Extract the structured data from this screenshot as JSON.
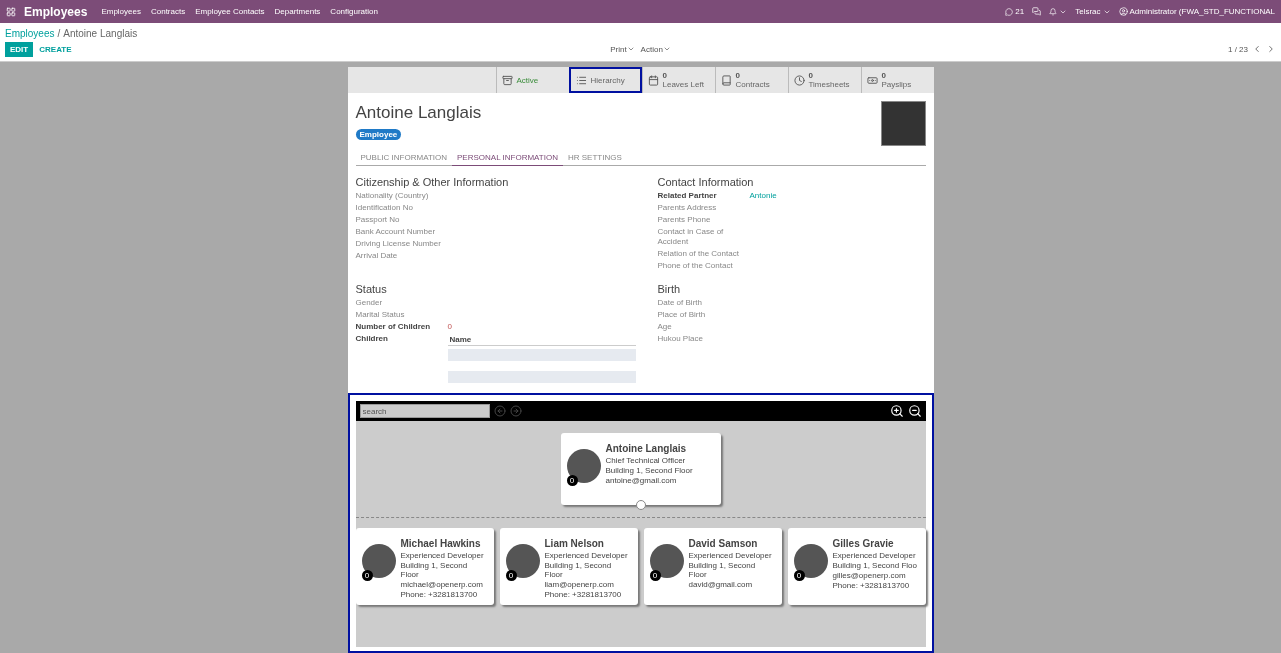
{
  "navbar": {
    "app_title": "Employees",
    "menu": [
      "Employees",
      "Contracts",
      "Employee Contacts",
      "Departments",
      "Configuration"
    ],
    "chat_count": "21",
    "company": "Telsrac",
    "user": "Administrator (FWA_STD_FUNCTIONAL"
  },
  "breadcrumb": {
    "parent": "Employees",
    "separator": "/",
    "current": "Antoine Langlais"
  },
  "actions": {
    "edit": "EDIT",
    "create": "CREATE",
    "print": "Print",
    "action": "Action",
    "pager": "1 / 23"
  },
  "smart_buttons": [
    {
      "kind": "archive",
      "label": "Active",
      "highlighted": false
    },
    {
      "kind": "list",
      "label": "Hierarchy",
      "highlighted": true
    },
    {
      "kind": "calendar",
      "count": "0",
      "label": "Leaves Left",
      "highlighted": false
    },
    {
      "kind": "book",
      "count": "0",
      "label": "Contracts",
      "highlighted": false
    },
    {
      "kind": "clock",
      "count": "0",
      "label": "Timesheets",
      "highlighted": false
    },
    {
      "kind": "money",
      "count": "0",
      "label": "Payslips",
      "highlighted": false
    }
  ],
  "employee": {
    "name": "Antoine Langlais",
    "tag": "Employee"
  },
  "tabs": [
    {
      "label": "PUBLIC INFORMATION",
      "selected": false
    },
    {
      "label": "PERSONAL INFORMATION",
      "selected": true
    },
    {
      "label": "HR SETTINGS",
      "selected": false
    }
  ],
  "groups": [
    {
      "title": "Citizenship & Other Information",
      "fields": [
        {
          "label": "Nationality (Country)",
          "required": false
        },
        {
          "label": "Identification No",
          "required": false
        },
        {
          "label": "Passport No",
          "required": false
        },
        {
          "label": "Bank Account Number",
          "required": false
        },
        {
          "label": "Driving License Number",
          "required": false
        },
        {
          "label": "Arrival Date",
          "required": false
        }
      ]
    },
    {
      "title": "Contact Information",
      "fields": [
        {
          "label": "Related Partner",
          "required": true,
          "kind": "link",
          "value": "Antonie"
        },
        {
          "label": "Parents Address",
          "required": false
        },
        {
          "label": "Parents Phone",
          "required": false
        },
        {
          "label": "Contact in Case of Accident",
          "required": false
        },
        {
          "label": "Relation of the Contact",
          "required": false
        },
        {
          "label": "Phone of the Contact",
          "required": false
        }
      ]
    },
    {
      "title": "Status",
      "fields": [
        {
          "label": "Gender",
          "required": false
        },
        {
          "label": "Marital Status",
          "required": false
        },
        {
          "label": "Number of Children",
          "required": true,
          "kind": "text",
          "value": "0"
        },
        {
          "label": "Children",
          "required": true,
          "kind": "table",
          "column": "Name"
        }
      ]
    },
    {
      "title": "Birth",
      "fields": [
        {
          "label": "Date of Birth",
          "required": false
        },
        {
          "label": "Place of Birth",
          "required": false
        },
        {
          "label": "Age",
          "required": false
        },
        {
          "label": "Hukou Place",
          "required": false
        }
      ]
    }
  ],
  "hierarchy": {
    "search": {
      "placeholder": "search"
    },
    "root": {
      "name": "Antoine Langlais",
      "job": "Chief Technical Officer",
      "address": "Building 1, Second Floor",
      "email": "antoine@gmail.com",
      "badge": "0"
    },
    "children": [
      {
        "name": "Michael Hawkins",
        "job": "Experienced Developer",
        "address": "Building 1, Second Floor",
        "email": "michael@openerp.com",
        "phone": "Phone: +3281813700",
        "badge": "0"
      },
      {
        "name": "Liam Nelson",
        "job": "Experienced Developer",
        "address": "Building 1, Second Floor",
        "email": "liam@openerp.com",
        "phone": "Phone: +3281813700",
        "badge": "0"
      },
      {
        "name": "David Samson",
        "job": "Experienced Developer",
        "address": "Building 1, Second Floor",
        "email": "david@gmail.com",
        "badge": "0"
      },
      {
        "name": "Gilles Gravie",
        "job": "Experienced Developer",
        "address": "Building 1, Second Floo",
        "email": "gilles@openerp.com",
        "phone": "Phone: +3281813700",
        "badge": "0"
      }
    ]
  }
}
